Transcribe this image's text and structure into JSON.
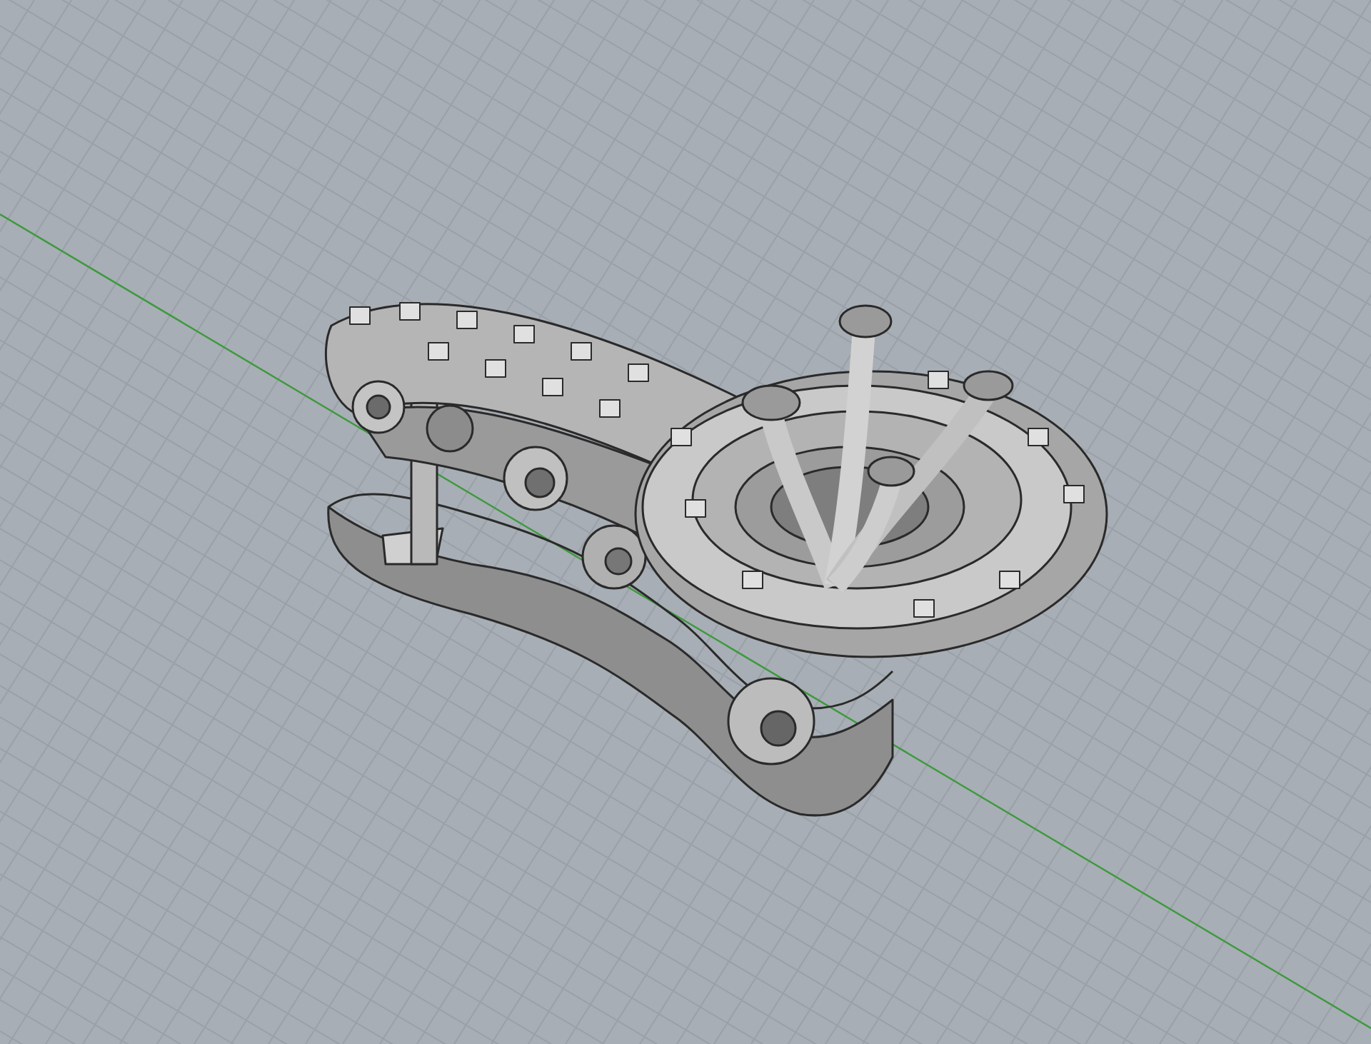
{
  "viewport": {
    "grid": true,
    "x_axis": true
  }
}
